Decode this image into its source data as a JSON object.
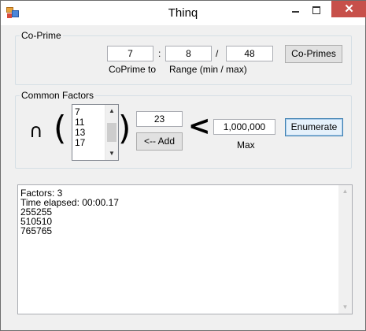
{
  "window": {
    "title": "Thinq"
  },
  "coprime": {
    "group_label": "Co-Prime",
    "coprime_value": "7",
    "separator_colon": ":",
    "range_min": "8",
    "separator_slash": "/",
    "range_max": "48",
    "button_label": "Co-Primes",
    "coprime_caption": "CoPrime to",
    "range_caption": "Range (min / max)"
  },
  "common_factors": {
    "group_label": "Common Factors",
    "intersect_symbol": "∩",
    "open_paren": "(",
    "close_paren": ")",
    "list_items": [
      "7",
      "11",
      "13",
      "17"
    ],
    "add_value": "23",
    "add_button_label": "<-- Add",
    "less_than_symbol": "<",
    "max_value": "1,000,000",
    "max_caption": "Max",
    "enumerate_label": "Enumerate"
  },
  "output": {
    "lines": [
      "Factors: 3",
      "Time elapsed: 00:00.17",
      "255255",
      "510510",
      "765765"
    ]
  },
  "colors": {
    "close_button": "#c7504a",
    "group_border": "#d5dfe5",
    "focus_border": "#3c7fb1"
  },
  "icons": {
    "app": "app-icon",
    "minimize": "minimize-icon",
    "maximize": "maximize-icon",
    "close": "close-icon"
  }
}
